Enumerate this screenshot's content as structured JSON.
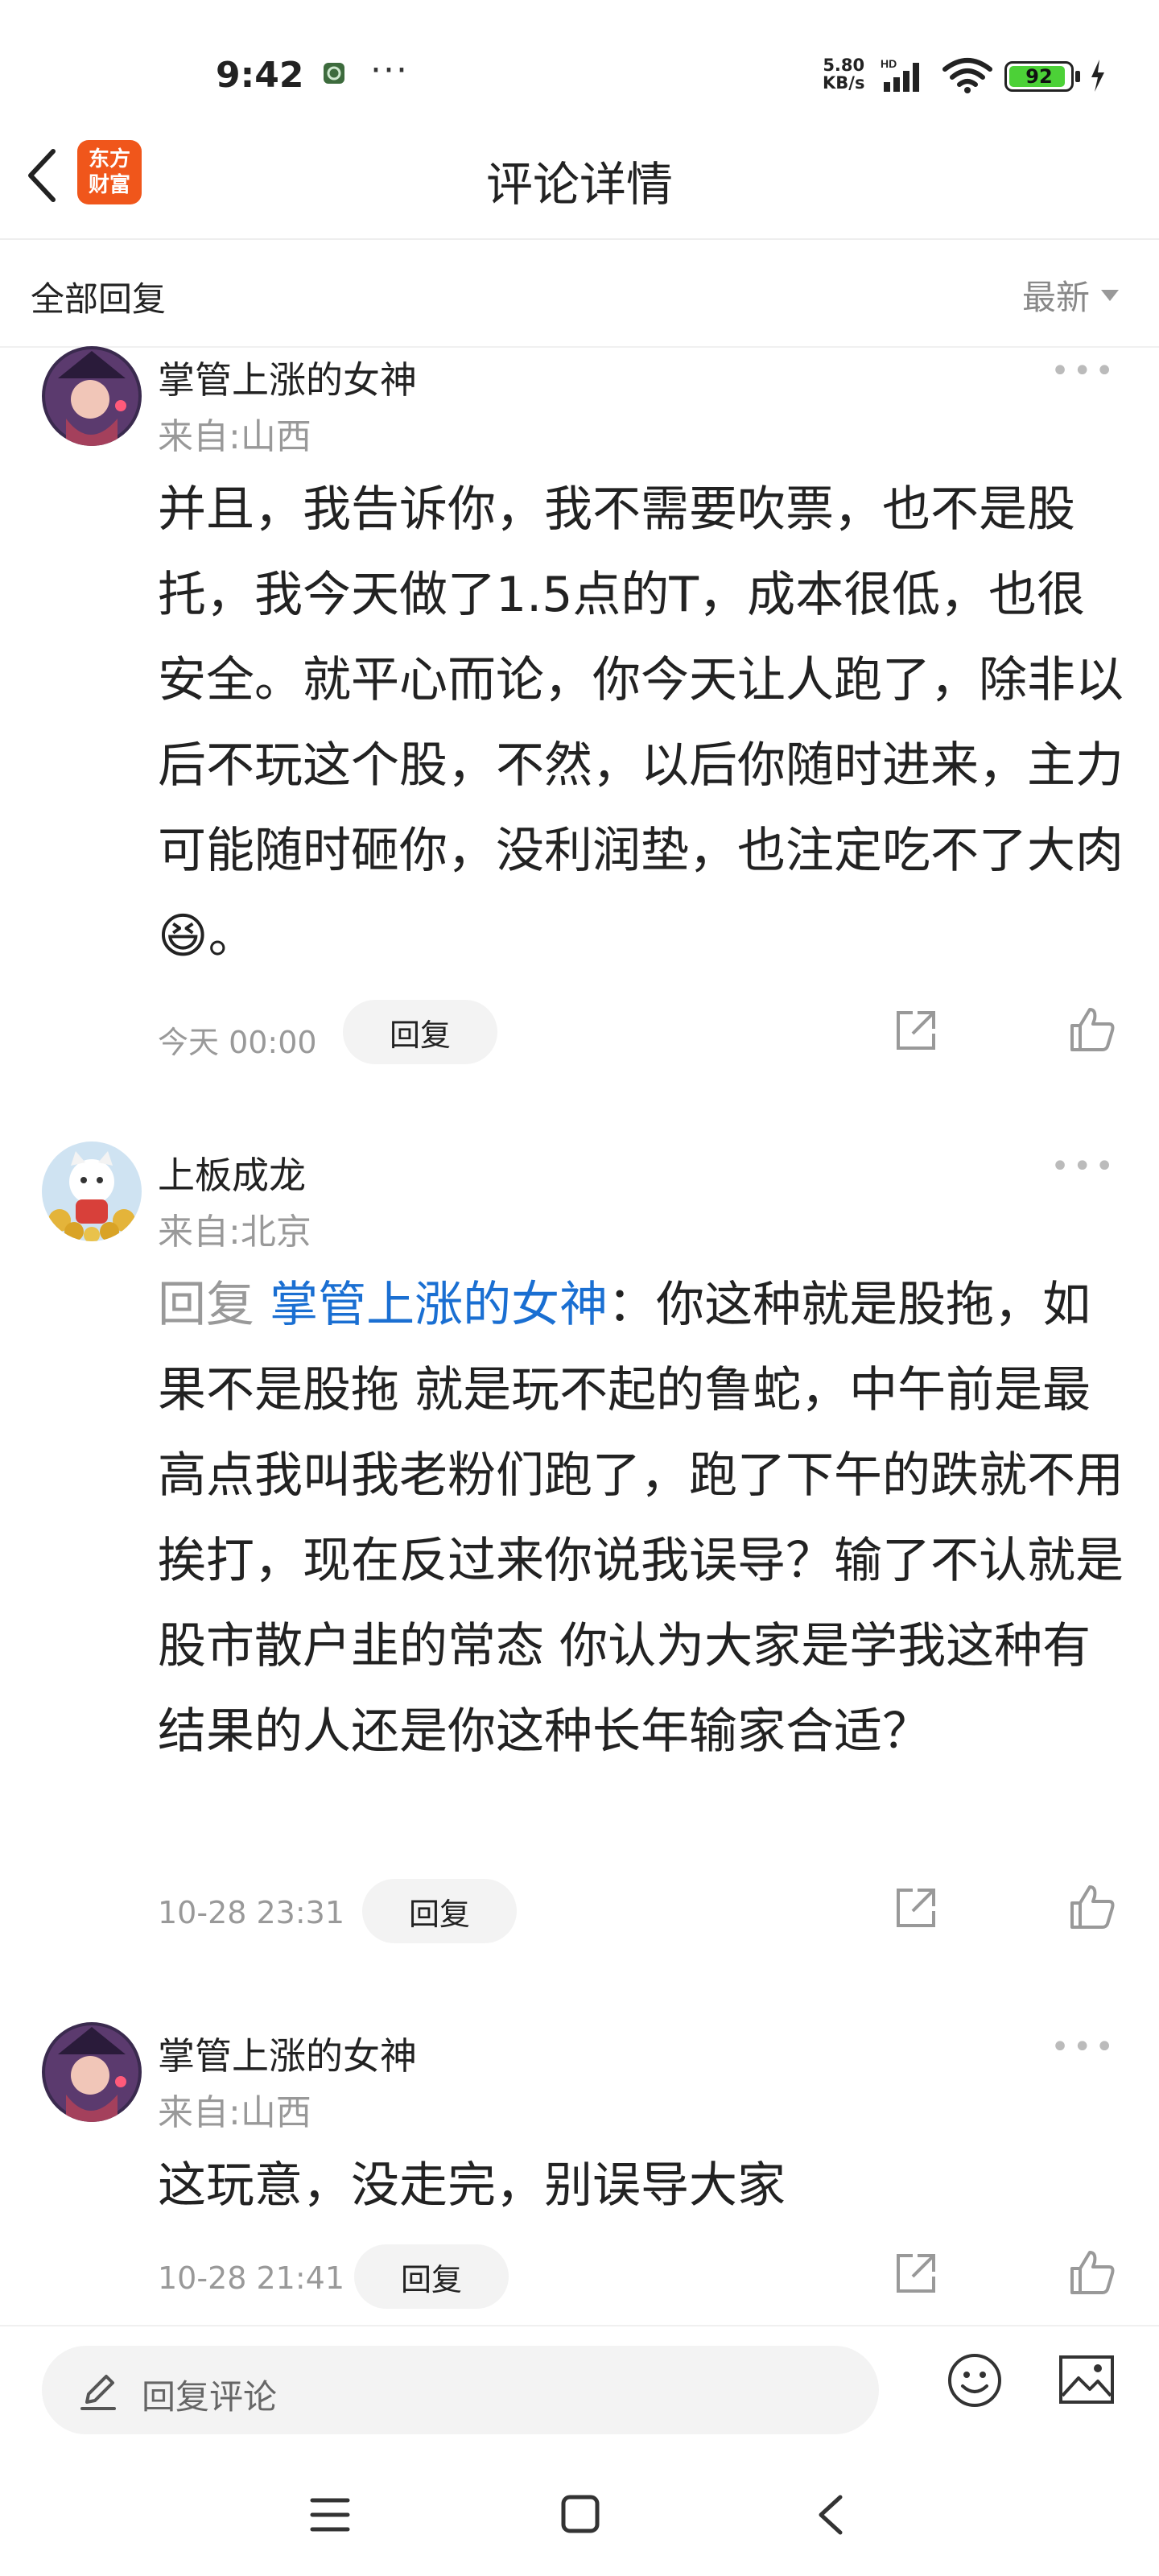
{
  "status_bar": {
    "time": "9:42",
    "more": "···",
    "net_speed_value": "5.80",
    "net_speed_unit": "KB/s",
    "network_label": "HD",
    "battery": "92"
  },
  "header": {
    "title": "评论详情",
    "logo_line1": "东方",
    "logo_line2": "财富"
  },
  "subheader": {
    "all_replies": "全部回复",
    "sort": "最新"
  },
  "comments": [
    {
      "user": "掌管上涨的女神",
      "location": "来自:山西",
      "text": "并且，我告诉你，我不需要吹票，也不是股托，我今天做了1.5点的T，成本很低，也很安全。就平心而论，你今天让人跑了，除非以后不玩这个股，不然，以后你随时进来，主力可能随时砸你，没利润垫，也注定吃不了大肉",
      "emoji": "😆",
      "text_end": "。",
      "time": "今天 00:00",
      "reply_label": "回复"
    },
    {
      "user": "上板成龙",
      "location": "来自:北京",
      "reply_prefix": "回复 ",
      "reply_target": "掌管上涨的女神",
      "text": "：你这种就是股拖，如果不是股拖 就是玩不起的鲁蛇，中午前是最高点我叫我老粉们跑了，跑了下午的跌就不用挨打，现在反过来你说我误导？输了不认就是股市散户韭的常态 你认为大家是学我这种有结果的人还是你这种长年输家合适？",
      "time": "10-28 23:31",
      "reply_label": "回复"
    },
    {
      "user": "掌管上涨的女神",
      "location": "来自:山西",
      "text": "这玩意，没走完，别误导大家",
      "time": "10-28 21:41",
      "reply_label": "回复"
    }
  ],
  "footer": {
    "input_placeholder": "回复评论"
  },
  "colors": {
    "brand": "#f0561b",
    "link": "#1a6fd2",
    "battery": "#4cd137"
  }
}
